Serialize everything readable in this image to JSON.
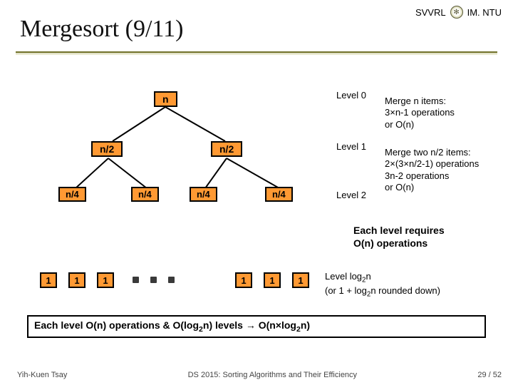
{
  "header": {
    "svvrl": "SVVRL",
    "at": "@",
    "org": "IM. NTU"
  },
  "title": "Mergesort (9/11)",
  "nodes": {
    "root": "n",
    "l1a": "n/2",
    "l1b": "n/2",
    "l2": [
      "n/4",
      "n/4",
      "n/4",
      "n/4"
    ]
  },
  "levels": {
    "l0": "Level 0",
    "l1": "Level 1",
    "l2": "Level 2"
  },
  "annot": {
    "a0_line1": "Merge n items:",
    "a0_line2": "3×n-1 operations",
    "a0_line3": "or O(n)",
    "a1_line1": "Merge two n/2 items:",
    "a1_line2": "2×(3×n/2-1) operations",
    "a1_line3": "3n-2 operations",
    "a1_line4": "or O(n)"
  },
  "each_level_1": "Each level requires",
  "each_level_2": "O(n) operations",
  "leaves": [
    "1",
    "1",
    "1",
    "1",
    "1",
    "1"
  ],
  "bottom_a1": "Level log",
  "bottom_a1b": "2",
  "bottom_a1c": "n",
  "bottom_a2": "(or 1 + log",
  "bottom_a2b": "2",
  "bottom_a2c": "n rounded down)",
  "conclusion_a": "Each level O(n) operations & O(log",
  "conclusion_b": "2",
  "conclusion_c": "n) levels ",
  "conclusion_arrow": "→",
  "conclusion_d": " O(n×log",
  "conclusion_e": "2",
  "conclusion_f": "n)",
  "footer": {
    "left": "Yih-Kuen Tsay",
    "center": "DS 2015: Sorting Algorithms and Their Efficiency",
    "right": "29 / 52"
  }
}
